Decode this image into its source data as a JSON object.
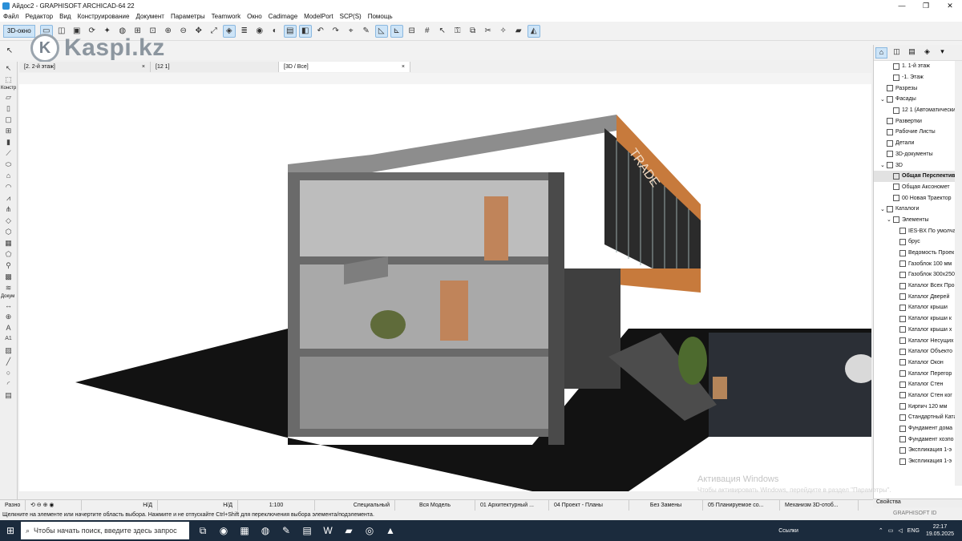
{
  "window": {
    "title": "Айдос2 - GRAPHISOFT ARCHICAD-64 22",
    "min": "—",
    "max": "❐",
    "close": "✕"
  },
  "menu": [
    "Файл",
    "Редактор",
    "Вид",
    "Конструирование",
    "Документ",
    "Параметры",
    "Teamwork",
    "Окно",
    "Cadimage",
    "ModelPort",
    "SCP(S)",
    "Помощь"
  ],
  "toolbar": {
    "view3d_label": "3D-окно"
  },
  "logo": {
    "text": "Kaspi.kz"
  },
  "tabs": [
    {
      "label": "[2. 2-й этаж]",
      "close": "×"
    },
    {
      "label": "[12 1]",
      "close": ""
    },
    {
      "label": "[3D / Все]",
      "close": "×"
    }
  ],
  "leftbar": {
    "section1": "Констр",
    "section2": "Докум",
    "a1": "A1"
  },
  "navigator": {
    "items": [
      {
        "label": "1. 1-й этаж",
        "indent": 2,
        "caret": ""
      },
      {
        "label": "-1. Этаж",
        "indent": 2,
        "caret": ""
      },
      {
        "label": "Разрезы",
        "indent": 1,
        "caret": ""
      },
      {
        "label": "Фасады",
        "indent": 1,
        "caret": "⌄"
      },
      {
        "label": "12 1 (Автоматически",
        "indent": 2,
        "caret": ""
      },
      {
        "label": "Развертки",
        "indent": 1,
        "caret": ""
      },
      {
        "label": "Рабочие Листы",
        "indent": 1,
        "caret": ""
      },
      {
        "label": "Детали",
        "indent": 1,
        "caret": ""
      },
      {
        "label": "3D-документы",
        "indent": 1,
        "caret": ""
      },
      {
        "label": "3D",
        "indent": 1,
        "caret": "⌄"
      },
      {
        "label": "Общая Перспектив",
        "indent": 2,
        "caret": "",
        "selected": true
      },
      {
        "label": "Общая Аксономет",
        "indent": 2,
        "caret": ""
      },
      {
        "label": "00 Новая Траектор",
        "indent": 2,
        "caret": ""
      },
      {
        "label": "Каталоги",
        "indent": 1,
        "caret": "⌄"
      },
      {
        "label": "Элементы",
        "indent": 2,
        "caret": "⌄"
      },
      {
        "label": "IES-BX По умолча",
        "indent": 3,
        "caret": ""
      },
      {
        "label": "брус",
        "indent": 3,
        "caret": ""
      },
      {
        "label": "Ведомость Проек",
        "indent": 3,
        "caret": ""
      },
      {
        "label": "Газоблок 100 мм",
        "indent": 3,
        "caret": ""
      },
      {
        "label": "Газоблок 300х250",
        "indent": 3,
        "caret": ""
      },
      {
        "label": "Каталог Всех Про",
        "indent": 3,
        "caret": ""
      },
      {
        "label": "Каталог Дверей",
        "indent": 3,
        "caret": ""
      },
      {
        "label": "Каталог крыши",
        "indent": 3,
        "caret": ""
      },
      {
        "label": "Каталог крыши к",
        "indent": 3,
        "caret": ""
      },
      {
        "label": "Каталог крыши х",
        "indent": 3,
        "caret": ""
      },
      {
        "label": "Каталог Несущих",
        "indent": 3,
        "caret": ""
      },
      {
        "label": "Каталог Объекто",
        "indent": 3,
        "caret": ""
      },
      {
        "label": "Каталог Окон",
        "indent": 3,
        "caret": ""
      },
      {
        "label": "Каталог Перегор",
        "indent": 3,
        "caret": ""
      },
      {
        "label": "Каталог Стен",
        "indent": 3,
        "caret": ""
      },
      {
        "label": "Каталог Стен ког",
        "indent": 3,
        "caret": ""
      },
      {
        "label": "Кирпич 120 мм",
        "indent": 3,
        "caret": ""
      },
      {
        "label": "Стандартный Ката",
        "indent": 3,
        "caret": ""
      },
      {
        "label": "Фундамент дома",
        "indent": 3,
        "caret": ""
      },
      {
        "label": "Фундамент хозпо",
        "indent": 3,
        "caret": ""
      },
      {
        "label": "Экспликация 1-э",
        "indent": 3,
        "caret": ""
      },
      {
        "label": "Экспликация 1-э",
        "indent": 3,
        "caret": ""
      }
    ],
    "properties_label": "Свойства"
  },
  "status": {
    "mode": "Разно",
    "nd1": "Н/Д",
    "nd2": "Н/Д",
    "scale": "1:100",
    "layer_combo": "Специальный",
    "model": "Вся Модель",
    "arch": "01 Архитектурный ...",
    "proj": "04 Проект - Планы",
    "replace": "Без Замены",
    "planned": "05 Планируемое со...",
    "mech": "Механизм 3D-отоб..."
  },
  "hint": "Щелкните на элементе или начертите область выбора. Нажмите и не отпускайте Ctrl+Shift для переключения выбора элемента/подэлемента.",
  "graphisoft": "GRAPHISOFT ID",
  "watermark": {
    "line1": "Активация Windows",
    "line2": "Чтобы активировать Windows, перейдите в раздел \"Параметры\"."
  },
  "building": {
    "sign": "TRADE"
  },
  "taskbar": {
    "search_placeholder": "Чтобы начать поиск, введите здесь запрос",
    "links": "Ссылки",
    "lang": "ENG",
    "time": "22:17",
    "date": "19.05.2025"
  },
  "colors": {
    "accent": "#cde4f7",
    "taskbar": "#1b2b3d",
    "wood": "#c77a3c",
    "concrete": "#5c5c5c"
  }
}
